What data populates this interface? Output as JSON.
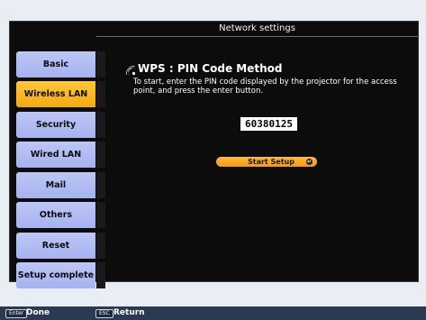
{
  "panel": {
    "title": "Network settings"
  },
  "tabs": [
    {
      "label": "Basic",
      "active": false
    },
    {
      "label": "Wireless LAN",
      "active": true
    },
    {
      "label": "Security",
      "active": false
    },
    {
      "label": "Wired LAN",
      "active": false
    },
    {
      "label": "Mail",
      "active": false
    },
    {
      "label": "Others",
      "active": false
    },
    {
      "label": "Reset",
      "active": false
    },
    {
      "label": "Setup complete",
      "active": false
    }
  ],
  "content": {
    "title": "WPS : PIN Code Method",
    "description": "To start, enter the PIN code displayed by the projector for the access point, and press the enter button.",
    "pin_code": "60380125",
    "start_button": "Start Setup"
  },
  "footer": {
    "enter_key": "Enter",
    "enter_label": "Done",
    "esc_key": "ESC",
    "esc_label": "Return"
  },
  "colors": {
    "tab_inactive": "#a6b2ef",
    "tab_active": "#f4a90e",
    "panel_bg": "#0c0c0c",
    "footer_bg": "#2b3a52",
    "page_bg": "#e9eef4"
  }
}
